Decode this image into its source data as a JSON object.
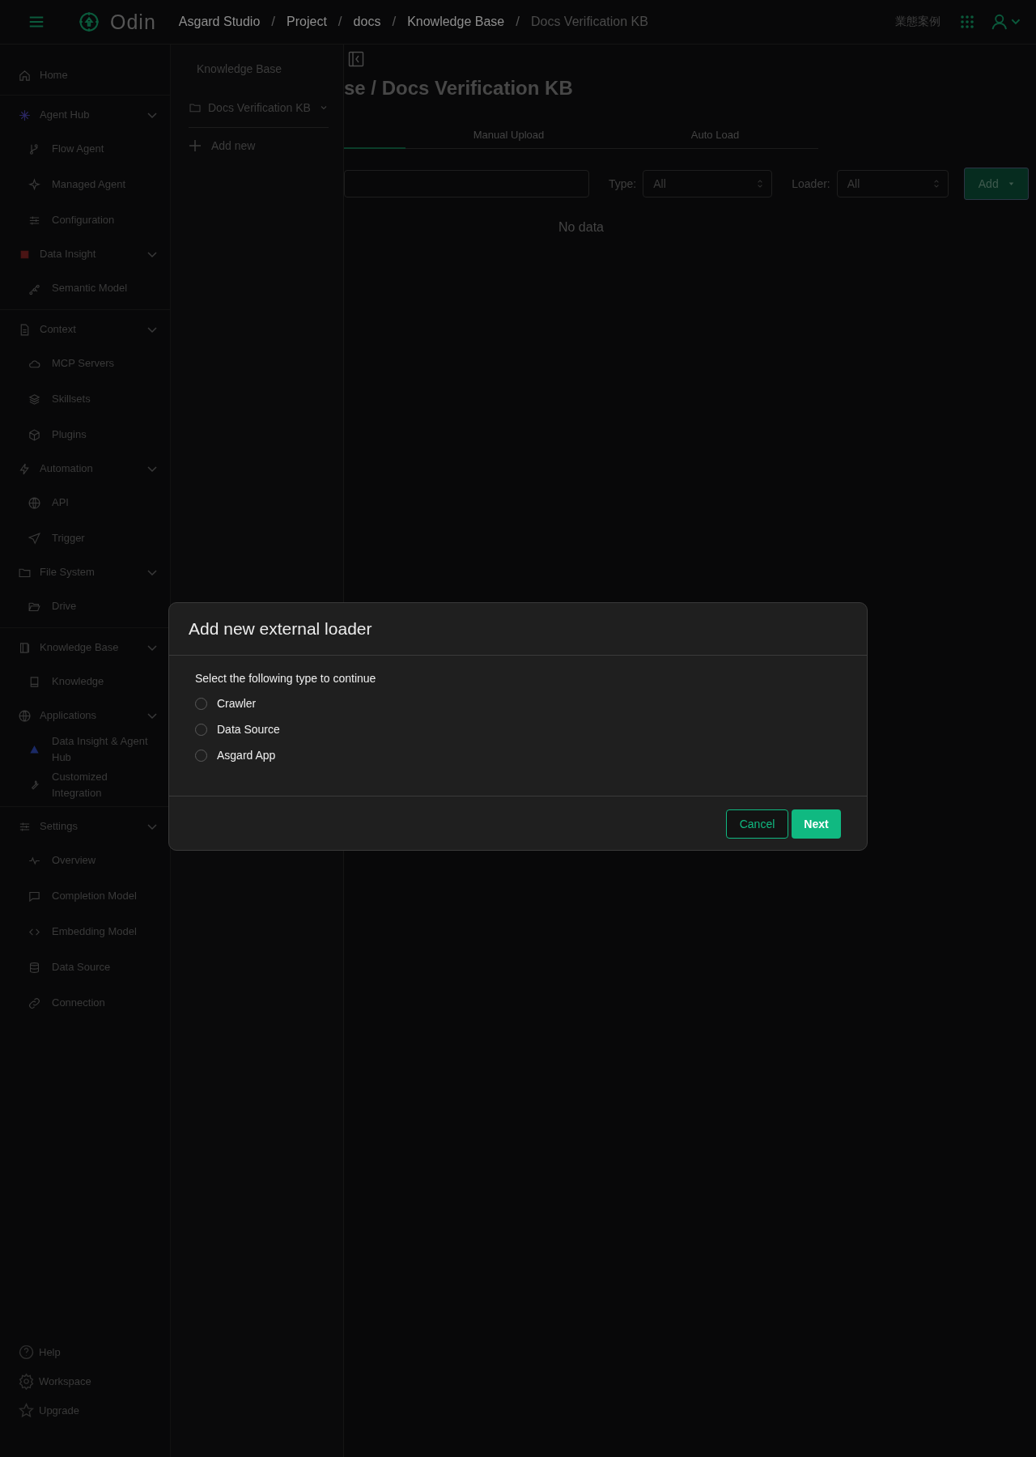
{
  "topbar": {
    "logo": "Odin",
    "breadcrumbs": [
      {
        "label": "Asgard Studio",
        "current": false
      },
      {
        "label": "Project",
        "current": false
      },
      {
        "label": "docs",
        "current": false
      },
      {
        "label": "Knowledge Base",
        "current": false
      },
      {
        "label": "Docs Verification KB",
        "current": true
      }
    ],
    "separator": "/",
    "cases_link": "業態案例"
  },
  "sidebar": {
    "sections": [
      {
        "items": [
          {
            "kind": "link",
            "label": "Home"
          }
        ]
      },
      {
        "items": [
          {
            "kind": "group",
            "label": "Agent Hub",
            "expanded": true,
            "children": [
              {
                "label": "Flow Agent"
              },
              {
                "label": "Managed Agent"
              },
              {
                "label": "Configuration"
              }
            ]
          },
          {
            "kind": "group",
            "label": "Data Insight",
            "expanded": true,
            "children": [
              {
                "label": "Semantic Model"
              }
            ]
          }
        ]
      },
      {
        "items": [
          {
            "kind": "group",
            "label": "Context",
            "expanded": true,
            "children": [
              {
                "label": "MCP Servers"
              },
              {
                "label": "Skillsets"
              },
              {
                "label": "Plugins"
              }
            ]
          },
          {
            "kind": "group",
            "label": "Automation",
            "expanded": true,
            "children": [
              {
                "label": "API"
              },
              {
                "label": "Trigger"
              }
            ]
          },
          {
            "kind": "group",
            "label": "File System",
            "expanded": true,
            "children": [
              {
                "label": "Drive"
              }
            ]
          }
        ]
      },
      {
        "items": [
          {
            "kind": "group",
            "label": "Knowledge Base",
            "expanded": true,
            "children": [
              {
                "label": "Knowledge"
              }
            ]
          },
          {
            "kind": "group",
            "label": "Applications",
            "expanded": true,
            "children": [
              {
                "label": "Data Insight & Agent Hub"
              },
              {
                "label": "Customized Integration"
              }
            ]
          }
        ]
      },
      {
        "items": [
          {
            "kind": "group",
            "label": "Settings",
            "expanded": true,
            "children": [
              {
                "label": "Overview"
              },
              {
                "label": "Completion Model"
              },
              {
                "label": "Embedding Model"
              },
              {
                "label": "Data Source"
              },
              {
                "label": "Connection"
              }
            ]
          }
        ]
      }
    ],
    "footer": [
      {
        "label": "Help"
      },
      {
        "label": "Workspace"
      },
      {
        "label": "Upgrade"
      }
    ]
  },
  "kb_panel": {
    "heading": "Knowledge Base",
    "items": [
      {
        "label": "Docs Verification KB",
        "expanded": false
      }
    ],
    "add_label": "Add new"
  },
  "main": {
    "title": "se / Docs Verification KB",
    "covered_tab": {
      "selected": true
    },
    "tabs": [
      {
        "label": "Manual Upload",
        "selected": false
      },
      {
        "label": "Auto Load",
        "selected": false
      }
    ],
    "filters": [
      {
        "label": "Type:",
        "value": "All"
      },
      {
        "label": "Loader:",
        "value": "All"
      }
    ],
    "add_button": "Add",
    "empty_text": "No data"
  },
  "modal": {
    "title": "Add new external loader",
    "prompt": "Select the following type to continue",
    "options": [
      {
        "label": "Crawler",
        "selected": false
      },
      {
        "label": "Data Source",
        "selected": false
      },
      {
        "label": "Asgard App",
        "selected": false
      }
    ],
    "cancel": "Cancel",
    "next": "Next"
  }
}
